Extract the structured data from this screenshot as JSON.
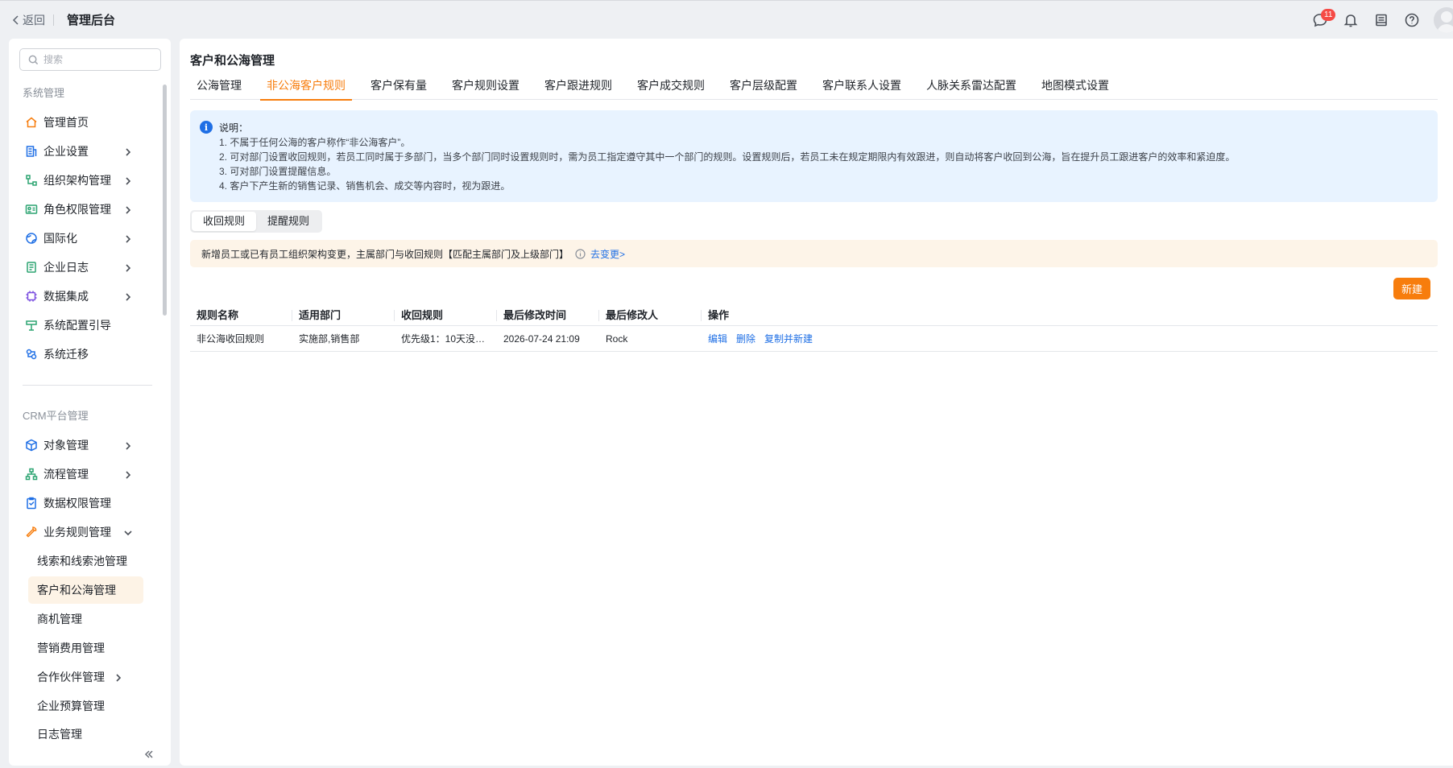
{
  "topbar": {
    "back_label": "返回",
    "app_title": "管理后台",
    "message_badge": "11",
    "icons": [
      "chat-icon",
      "bell-icon",
      "inbox-icon",
      "help-icon",
      "avatar"
    ]
  },
  "sidebar": {
    "search_placeholder": "搜索",
    "sections": [
      {
        "title": "系统管理",
        "items": [
          {
            "label": "管理首页",
            "icon": "home-icon",
            "has_children": false
          },
          {
            "label": "企业设置",
            "icon": "building-icon",
            "has_children": true
          },
          {
            "label": "组织架构管理",
            "icon": "org-icon",
            "has_children": true
          },
          {
            "label": "角色权限管理",
            "icon": "id-card-icon",
            "has_children": true
          },
          {
            "label": "国际化",
            "icon": "globe-icon",
            "has_children": true
          },
          {
            "label": "企业日志",
            "icon": "log-icon",
            "has_children": true
          },
          {
            "label": "数据集成",
            "icon": "chip-icon",
            "has_children": true
          },
          {
            "label": "系统配置引导",
            "icon": "guide-icon",
            "has_children": false
          },
          {
            "label": "系统迁移",
            "icon": "migrate-icon",
            "has_children": false
          }
        ]
      },
      {
        "title": "CRM平台管理",
        "items": [
          {
            "label": "对象管理",
            "icon": "cube-icon",
            "has_children": true
          },
          {
            "label": "流程管理",
            "icon": "flow-icon",
            "has_children": true
          },
          {
            "label": "数据权限管理",
            "icon": "clipboard-icon",
            "has_children": false
          },
          {
            "label": "业务规则管理",
            "icon": "tools-icon",
            "has_children": true,
            "expanded": true
          }
        ],
        "sub_items": [
          {
            "label": "线索和线索池管理",
            "active": false,
            "has_children": false
          },
          {
            "label": "客户和公海管理",
            "active": true,
            "has_children": false
          },
          {
            "label": "商机管理",
            "active": false,
            "has_children": false
          },
          {
            "label": "营销费用管理",
            "active": false,
            "has_children": false
          },
          {
            "label": "合作伙伴管理",
            "active": false,
            "has_children": true
          },
          {
            "label": "企业预算管理",
            "active": false,
            "has_children": false
          },
          {
            "label": "日志管理",
            "active": false,
            "has_children": false
          }
        ]
      }
    ]
  },
  "main": {
    "page_title": "客户和公海管理",
    "tabs": [
      "公海管理",
      "非公海客户规则",
      "客户保有量",
      "客户规则设置",
      "客户跟进规则",
      "客户成交规则",
      "客户层级配置",
      "客户联系人设置",
      "人脉关系雷达配置",
      "地图模式设置"
    ],
    "active_tab": 1,
    "notice": {
      "title": "说明：",
      "lines": [
        "1. 不属于任何公海的客户称作“非公海客户”。",
        "2. 可对部门设置收回规则，若员工同时属于多部门，当多个部门同时设置规则时，需为员工指定遵守其中一个部门的规则。设置规则后，若员工未在规定期限内有效跟进，则自动将客户收回到公海，旨在提升员工跟进客户的效率和紧迫度。",
        "3. 可对部门设置提醒信息。",
        "4. 客户下产生新的销售记录、销售机会、成交等内容时，视为跟进。"
      ]
    },
    "segments": [
      "收回规则",
      "提醒规则"
    ],
    "active_segment": 0,
    "warning": {
      "text": "新增员工或已有员工组织架构变更，主属部门与收回规则【匹配主属部门及上级部门】",
      "link": "去变更>"
    },
    "new_button": "新建",
    "table": {
      "columns": [
        "规则名称",
        "适用部门",
        "收回规则",
        "最后修改时间",
        "最后修改人",
        "操作"
      ],
      "rows": [
        {
          "name": "非公海收回规则",
          "departments": "实施部,销售部",
          "rule": "优先级1：10天没有…",
          "modified_time": "2026-07-24 21:09",
          "modified_by": "Rock",
          "actions": [
            "编辑",
            "删除",
            "复制并新建"
          ]
        }
      ]
    }
  },
  "colors": {
    "accent": "#f77d0d",
    "link": "#1f6fe5",
    "notice_bg": "#e8f3ff",
    "warning_bg": "#fdf4e8",
    "badge": "#f54a45"
  }
}
